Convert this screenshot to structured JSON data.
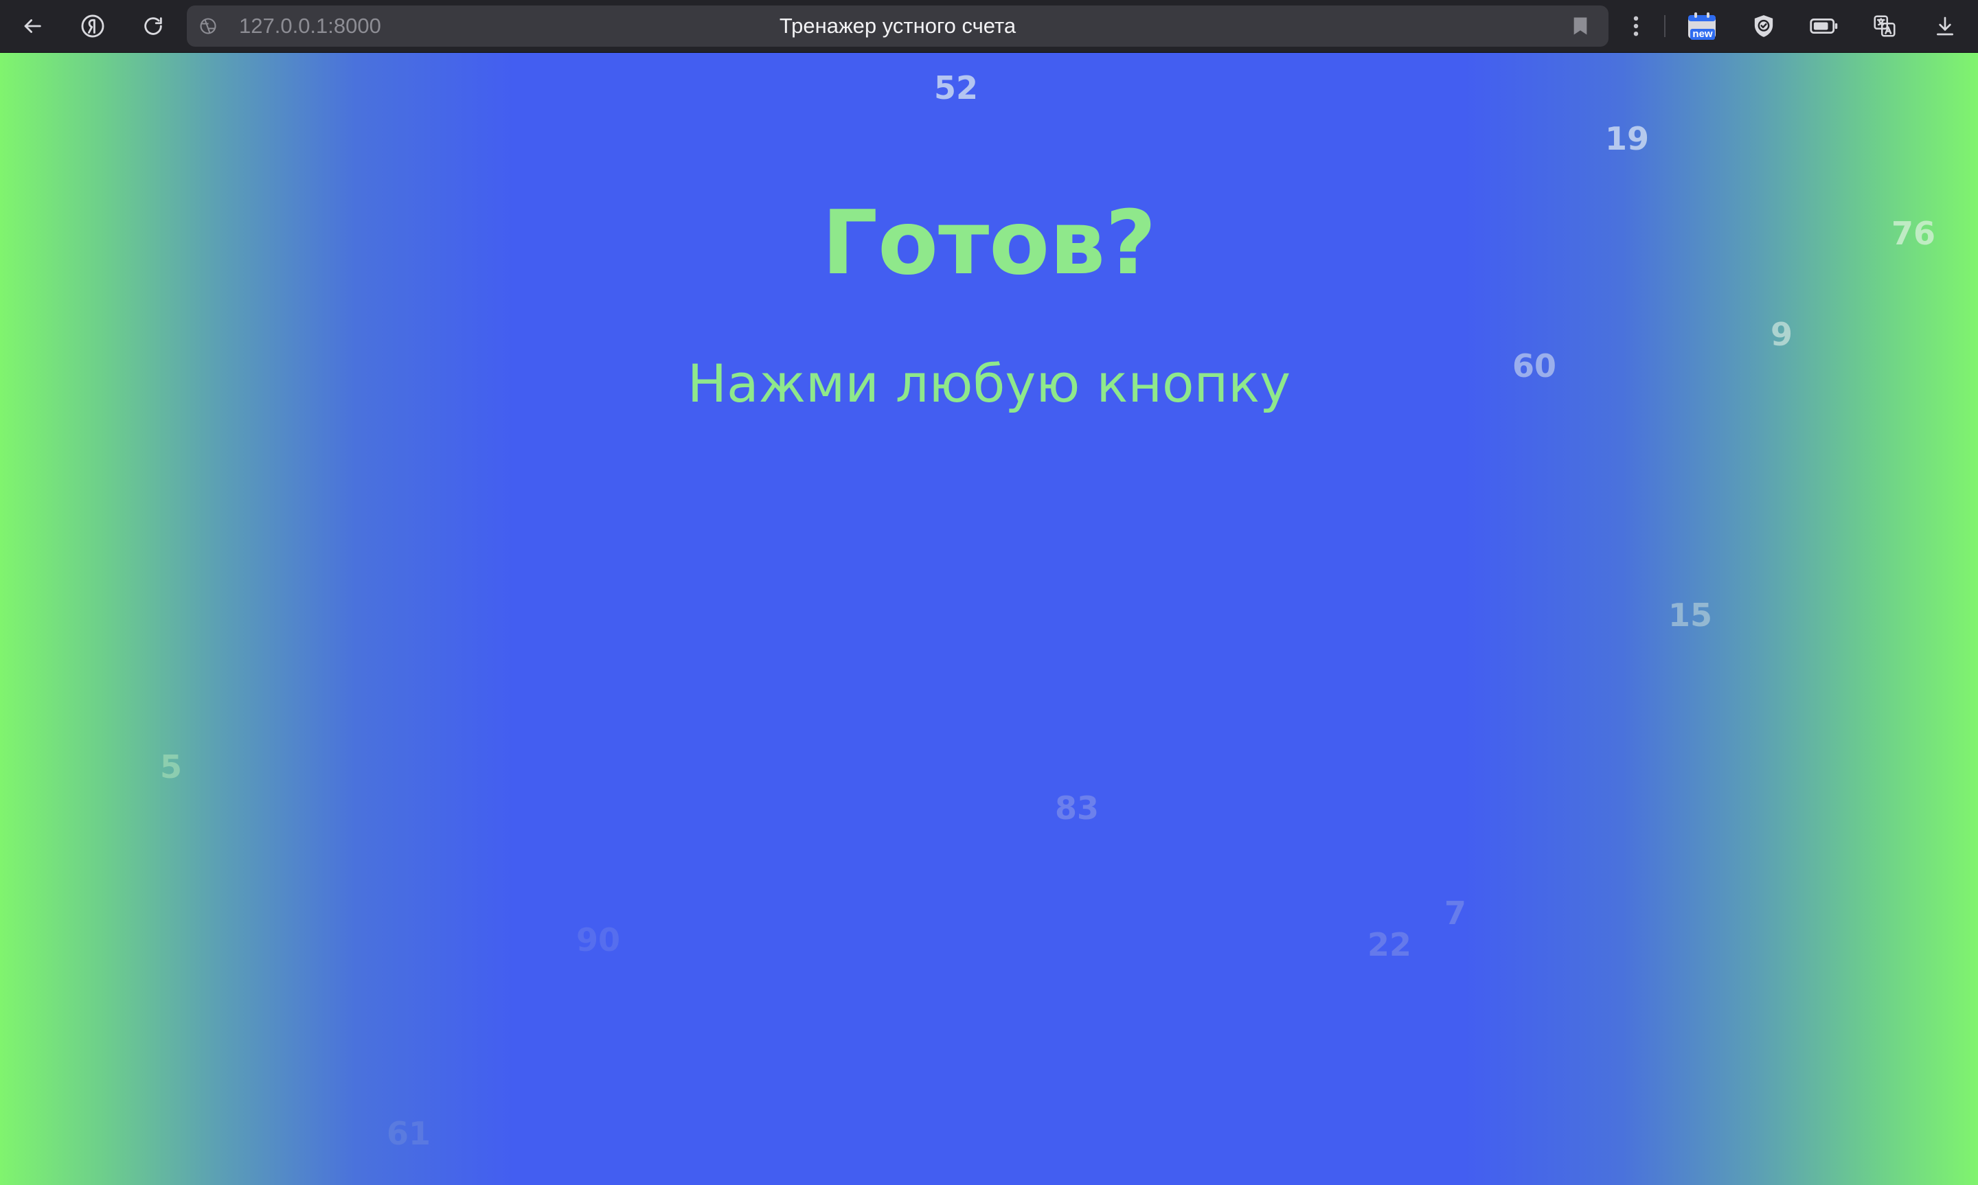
{
  "browser": {
    "url": "127.0.0.1:8000",
    "tab_title": "Тренажер устного счета",
    "new_badge": "new",
    "icons": {
      "back": "back-arrow-icon",
      "yandex": "yandex-logo-icon",
      "reload": "reload-icon",
      "site_info": "site-info-icon",
      "bookmark": "bookmark-icon",
      "menu": "more-menu-icon",
      "calendar": "calendar-new-icon",
      "protect": "protect-shield-icon",
      "battery": "battery-icon",
      "translate": "translate-icon",
      "downloads": "download-icon"
    }
  },
  "page": {
    "heading": "Готов?",
    "subheading": "Нажми любую кнопку",
    "colors": {
      "text_accent": "#8fe88b",
      "center_blue": "#435ef1",
      "edge_green": "#80f46e"
    },
    "floating_numbers": [
      {
        "value": "52",
        "opacity": 0.85
      },
      {
        "value": "19",
        "opacity": 0.85
      },
      {
        "value": "76",
        "opacity": 0.8
      },
      {
        "value": "9",
        "opacity": 0.75
      },
      {
        "value": "60",
        "opacity": 0.75
      },
      {
        "value": "15",
        "opacity": 0.65
      },
      {
        "value": "5",
        "opacity": 0.6
      },
      {
        "value": "83",
        "opacity": 0.55
      },
      {
        "value": "7",
        "opacity": 0.5
      },
      {
        "value": "22",
        "opacity": 0.5
      },
      {
        "value": "90",
        "opacity": 0.4
      },
      {
        "value": "61",
        "opacity": 0.35
      }
    ]
  }
}
